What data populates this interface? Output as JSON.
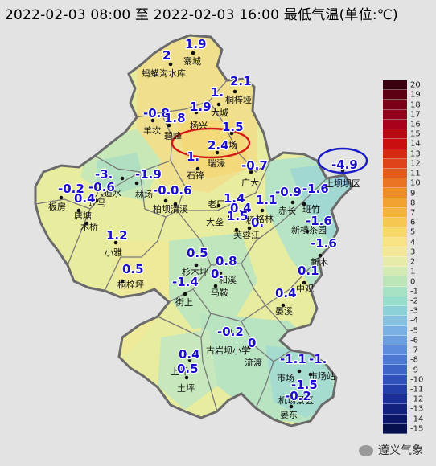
{
  "title": "2022-02-03 08:00 至 2022-02-03 16:00 最低气温(单位:℃)",
  "legend": {
    "levels": [
      20,
      19,
      18,
      17,
      16,
      15,
      14,
      13,
      12,
      11,
      10,
      9,
      8,
      7,
      6,
      5,
      4,
      3,
      2,
      1,
      0,
      -1,
      -2,
      -3,
      -4,
      -5,
      -6,
      -7,
      -8,
      -9,
      -10,
      -11,
      -12,
      -13,
      -14,
      -15
    ],
    "colors": [
      "#3a0010",
      "#5c0014",
      "#7a0018",
      "#90001a",
      "#a8001c",
      "#b80a14",
      "#c81010",
      "#d42a10",
      "#de4418",
      "#e45c1c",
      "#ea7424",
      "#ee8c28",
      "#f2a230",
      "#f4b43c",
      "#f6c850",
      "#f8d868",
      "#f8e484",
      "#f2e898",
      "#e6eca8",
      "#d2eab4",
      "#bce6b8",
      "#a8e2c4",
      "#98dccc",
      "#8cd0d8",
      "#88c0e0",
      "#7ab0e4",
      "#6c9ee0",
      "#5e8cdc",
      "#4c78d4",
      "#3e64c8",
      "#3050bc",
      "#243eaa",
      "#1a2e96",
      "#12207e",
      "#0c1666",
      "#06104e"
    ]
  },
  "stations": [
    {
      "name": "寨城",
      "value": "1.9"
    },
    {
      "name": "蚂蟥沟水库",
      "value": "2"
    },
    {
      "name": "桐梓垭",
      "value": "2.1"
    },
    {
      "name": "大城",
      "value": "1."
    },
    {
      "name": "羊坎",
      "value": "-0.8"
    },
    {
      "name": "碧峰",
      "value": "1.8"
    },
    {
      "name": "杨兴",
      "value": "1.9"
    },
    {
      "name": "场",
      "value": "1.5"
    },
    {
      "name": "瑞濠",
      "value": "2.4"
    },
    {
      "name": "石锋",
      "value": "1."
    },
    {
      "name": "广大",
      "value": "-0.7"
    },
    {
      "name": "八道水",
      "value": "-3."
    },
    {
      "name": "林场",
      "value": "-1.9"
    },
    {
      "name": "板房",
      "value": "-0.2"
    },
    {
      "name": "迁马",
      "value": "-0.6"
    },
    {
      "name": "唐塘",
      "value": "0.4"
    },
    {
      "name": "木桥",
      "value": ""
    },
    {
      "name": "柏坝",
      "value": "-0.9"
    },
    {
      "name": "清溪",
      "value": "0.6"
    },
    {
      "name": "老厂",
      "value": "1.4"
    },
    {
      "name": "大垄",
      "value": "0.4"
    },
    {
      "name": "芙蓉江",
      "value": "1.5"
    },
    {
      "name": "桥",
      "value": "0."
    },
    {
      "name": "格林",
      "value": "1.1"
    },
    {
      "name": "赤长",
      "value": "-0.9"
    },
    {
      "name": "班竹",
      "value": "-1.6"
    },
    {
      "name": "上坝坝区",
      "value": "-4.9"
    },
    {
      "name": "新横茶园",
      "value": "-1.6"
    },
    {
      "name": "小雅",
      "value": "1.2"
    },
    {
      "name": "桐梓坪",
      "value": "0.5"
    },
    {
      "name": "杉木坪",
      "value": "0.5"
    },
    {
      "name": "和溪",
      "value": "0.8"
    },
    {
      "name": "街上",
      "value": "-1.4"
    },
    {
      "name": "马鞍",
      "value": "0."
    },
    {
      "name": "新木",
      "value": "-1.6"
    },
    {
      "name": "中观",
      "value": "0.1"
    },
    {
      "name": "晏溪",
      "value": "0.4"
    },
    {
      "name": "古岩坝小学",
      "value": "-0.2"
    },
    {
      "name": "流渡",
      "value": "0"
    },
    {
      "name": "上坪",
      "value": "0.4"
    },
    {
      "name": "土坪",
      "value": "0.5"
    },
    {
      "name": "市场",
      "value": "-1.1"
    },
    {
      "name": "市场站",
      "value": "-1."
    },
    {
      "name": "机场景区",
      "value": "-1.5"
    },
    {
      "name": "晏东",
      "value": "-0.2"
    }
  ],
  "watermark": "遵义气象"
}
